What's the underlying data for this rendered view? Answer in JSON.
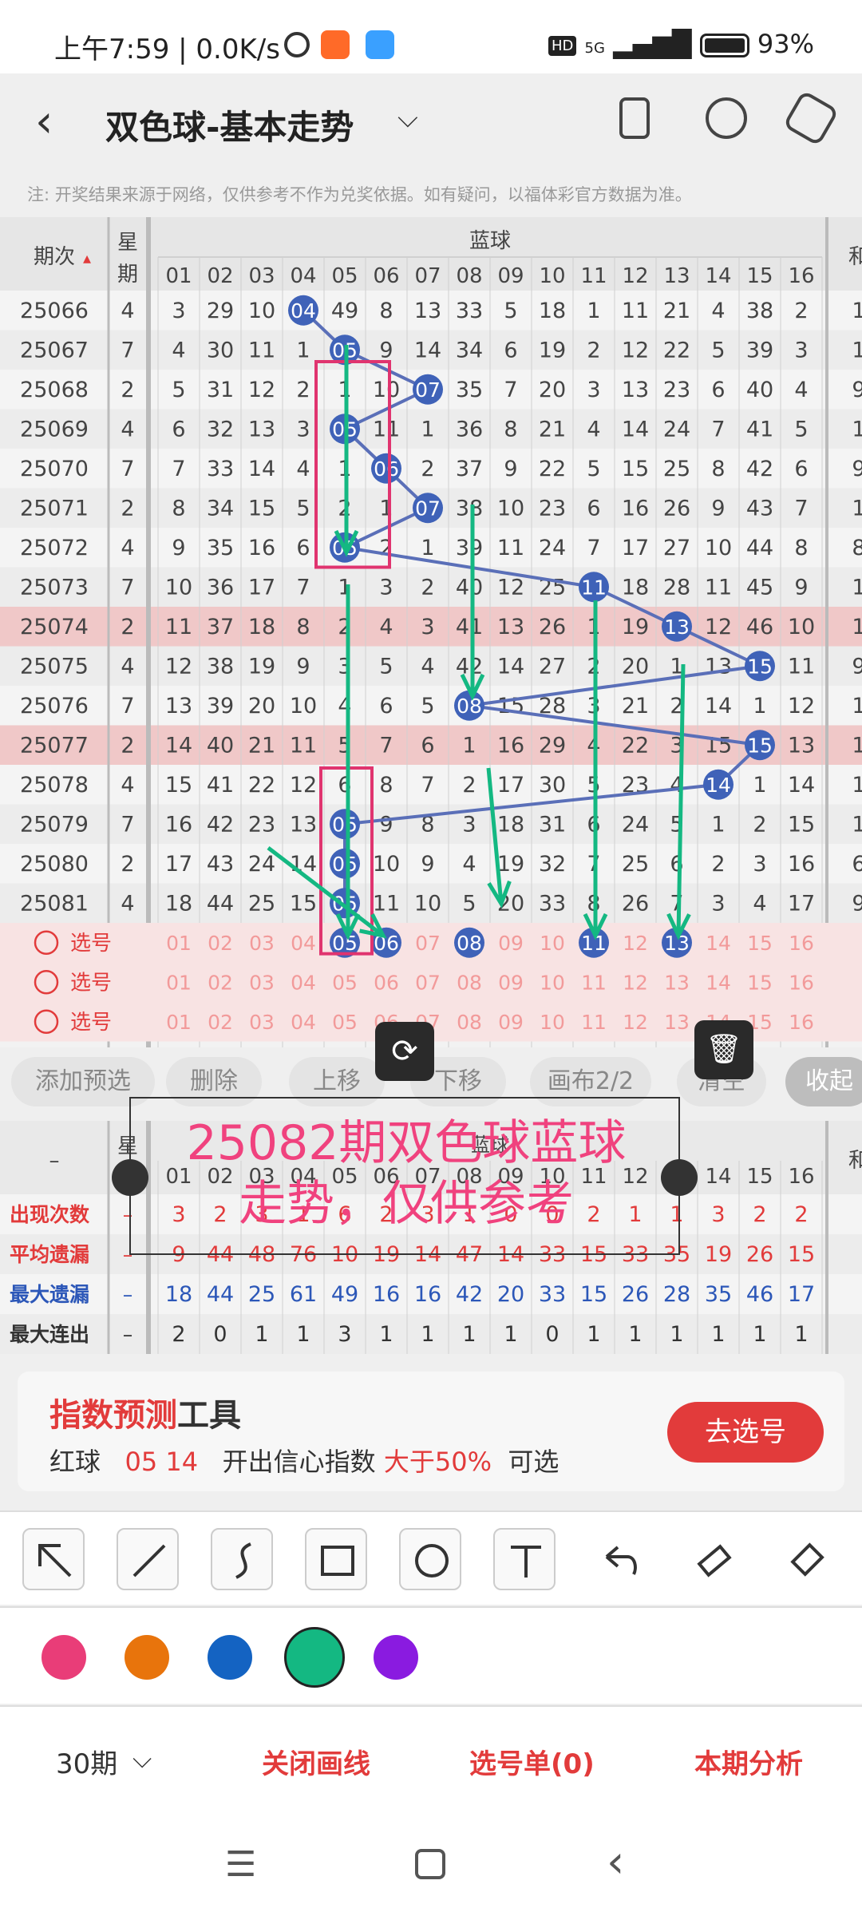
{
  "status": {
    "time": "上午7:59 | 0.0K/s",
    "network": "5G",
    "battery": "93%"
  },
  "header": {
    "title": "双色球-基本走势"
  },
  "notice": "注: 开奖结果来源于网络，仅供参考不作为兑奖依据。如有疑问，以福体彩官方数据为准。",
  "table": {
    "period_header": "期次",
    "weekday_header": "星期",
    "section_header": "蓝球",
    "last_col_header": "和",
    "columns": [
      "01",
      "02",
      "03",
      "04",
      "05",
      "06",
      "07",
      "08",
      "09",
      "10",
      "11",
      "12",
      "13",
      "14",
      "15",
      "16"
    ],
    "rows": [
      {
        "period": "25066",
        "weekday": "4",
        "cells": [
          "3",
          "29",
          "10",
          "04",
          "49",
          "8",
          "13",
          "33",
          "5",
          "18",
          "1",
          "11",
          "21",
          "4",
          "38",
          "2"
        ],
        "hit": 3
      },
      {
        "period": "25067",
        "weekday": "7",
        "cells": [
          "4",
          "30",
          "11",
          "1",
          "05",
          "9",
          "14",
          "34",
          "6",
          "19",
          "2",
          "12",
          "22",
          "5",
          "39",
          "3"
        ],
        "hit": 4
      },
      {
        "period": "25068",
        "weekday": "2",
        "cells": [
          "5",
          "31",
          "12",
          "2",
          "1",
          "10",
          "07",
          "35",
          "7",
          "20",
          "3",
          "13",
          "23",
          "6",
          "40",
          "4"
        ],
        "hit": 6
      },
      {
        "period": "25069",
        "weekday": "4",
        "cells": [
          "6",
          "32",
          "13",
          "3",
          "05",
          "11",
          "1",
          "36",
          "8",
          "21",
          "4",
          "14",
          "24",
          "7",
          "41",
          "5"
        ],
        "hit": 4
      },
      {
        "period": "25070",
        "weekday": "7",
        "cells": [
          "7",
          "33",
          "14",
          "4",
          "1",
          "06",
          "2",
          "37",
          "9",
          "22",
          "5",
          "15",
          "25",
          "8",
          "42",
          "6"
        ],
        "hit": 5
      },
      {
        "period": "25071",
        "weekday": "2",
        "cells": [
          "8",
          "34",
          "15",
          "5",
          "2",
          "1",
          "07",
          "38",
          "10",
          "23",
          "6",
          "16",
          "26",
          "9",
          "43",
          "7"
        ],
        "hit": 6
      },
      {
        "period": "25072",
        "weekday": "4",
        "cells": [
          "9",
          "35",
          "16",
          "6",
          "05",
          "2",
          "1",
          "39",
          "11",
          "24",
          "7",
          "17",
          "27",
          "10",
          "44",
          "8"
        ],
        "hit": 4
      },
      {
        "period": "25073",
        "weekday": "7",
        "cells": [
          "10",
          "36",
          "17",
          "7",
          "1",
          "3",
          "2",
          "40",
          "12",
          "25",
          "11",
          "18",
          "28",
          "11",
          "45",
          "9"
        ],
        "hit": 10
      },
      {
        "period": "25074",
        "weekday": "2",
        "cells": [
          "11",
          "37",
          "18",
          "8",
          "2",
          "4",
          "3",
          "41",
          "13",
          "26",
          "1",
          "19",
          "13",
          "12",
          "46",
          "10"
        ],
        "hit": 12
      },
      {
        "period": "25075",
        "weekday": "4",
        "cells": [
          "12",
          "38",
          "19",
          "9",
          "3",
          "5",
          "4",
          "42",
          "14",
          "27",
          "2",
          "20",
          "1",
          "13",
          "15",
          "11"
        ],
        "hit": 14
      },
      {
        "period": "25076",
        "weekday": "7",
        "cells": [
          "13",
          "39",
          "20",
          "10",
          "4",
          "6",
          "5",
          "08",
          "15",
          "28",
          "3",
          "21",
          "2",
          "14",
          "1",
          "12"
        ],
        "hit": 7
      },
      {
        "period": "25077",
        "weekday": "2",
        "cells": [
          "14",
          "40",
          "21",
          "11",
          "5",
          "7",
          "6",
          "1",
          "16",
          "29",
          "4",
          "22",
          "3",
          "15",
          "15",
          "13"
        ],
        "hit": 14
      },
      {
        "period": "25078",
        "weekday": "4",
        "cells": [
          "15",
          "41",
          "22",
          "12",
          "6",
          "8",
          "7",
          "2",
          "17",
          "30",
          "5",
          "23",
          "4",
          "14",
          "1",
          "14"
        ],
        "hit": 13
      },
      {
        "period": "25079",
        "weekday": "7",
        "cells": [
          "16",
          "42",
          "23",
          "13",
          "05",
          "9",
          "8",
          "3",
          "18",
          "31",
          "6",
          "24",
          "5",
          "1",
          "2",
          "15"
        ],
        "hit": 4
      },
      {
        "period": "25080",
        "weekday": "2",
        "cells": [
          "17",
          "43",
          "24",
          "14",
          "05",
          "10",
          "9",
          "4",
          "19",
          "32",
          "7",
          "25",
          "6",
          "2",
          "3",
          "16"
        ],
        "hit": 4
      },
      {
        "period": "25081",
        "weekday": "4",
        "cells": [
          "18",
          "44",
          "25",
          "15",
          "05",
          "11",
          "10",
          "5",
          "20",
          "33",
          "8",
          "26",
          "7",
          "3",
          "4",
          "17"
        ],
        "hit": 4
      }
    ],
    "last_col": [
      "1",
      "1",
      "9",
      "1",
      "9",
      "1",
      "8",
      "1",
      "1",
      "9",
      "1",
      "1",
      "1",
      "1",
      "6",
      "9"
    ],
    "select_label": "选号",
    "select_picks": [
      [
        4,
        5,
        7,
        10,
        12
      ],
      [],
      []
    ]
  },
  "actions": {
    "add": "添加预选",
    "delete": "删除",
    "up": "上移",
    "down": "下移",
    "canvas": "画布2/2",
    "clear": "清空",
    "collapse": "收起"
  },
  "annotation": "25082期双色球蓝球\n走势，仅供参考",
  "stats": {
    "rows": [
      {
        "label": "出现次数",
        "lead": "–",
        "values": [
          "3",
          "2",
          "3",
          "1",
          "6",
          "2",
          "3",
          "1",
          "0",
          "0",
          "2",
          "1",
          "1",
          "3",
          "2",
          "2"
        ],
        "color": "#e23b3b"
      },
      {
        "label": "平均遗漏",
        "lead": "–",
        "values": [
          "9",
          "44",
          "48",
          "76",
          "10",
          "19",
          "14",
          "47",
          "14",
          "33",
          "15",
          "33",
          "35",
          "19",
          "26",
          "15"
        ],
        "color": "#e23b3b"
      },
      {
        "label": "最大遗漏",
        "lead": "–",
        "values": [
          "18",
          "44",
          "25",
          "61",
          "49",
          "16",
          "16",
          "42",
          "20",
          "33",
          "15",
          "26",
          "28",
          "35",
          "46",
          "17"
        ],
        "color": "#2c57b8"
      },
      {
        "label": "最大连出",
        "lead": "–",
        "values": [
          "2",
          "0",
          "1",
          "1",
          "3",
          "1",
          "1",
          "1",
          "1",
          "0",
          "1",
          "1",
          "1",
          "1",
          "1",
          "1"
        ],
        "color": "#333"
      }
    ]
  },
  "promo": {
    "title_red": "指数预测",
    "title_black": "工具",
    "line_label": "红球",
    "line_nums": "05 14",
    "line_mid": "开出信心指数",
    "line_pct": "大于50%",
    "line_end": "可选",
    "button": "去选号"
  },
  "colors": [
    "#e93d78",
    "#e8740c",
    "#1463c2",
    "#14b882",
    "#8a1be0"
  ],
  "footer": {
    "period": "30期",
    "close_lines": "关闭画线",
    "ticket": "选号单(0)",
    "analysis": "本期分析"
  }
}
